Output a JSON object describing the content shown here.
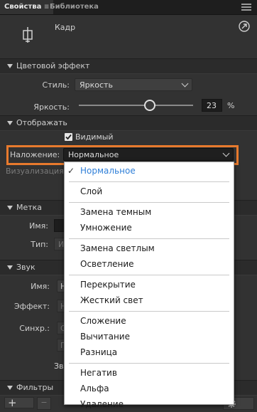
{
  "tabs": [
    {
      "label": "Свойства",
      "close": "≡"
    },
    {
      "label": "Библиотека",
      "close": ""
    }
  ],
  "header": {
    "object_type": "Кадр"
  },
  "color_effect": {
    "title": "Цветовой эффект",
    "style_label": "Стиль:",
    "style_value": "Яркость",
    "brightness_label": "Яркость:",
    "brightness_value": "23",
    "brightness_unit": "%",
    "brightness_slider_fraction": 0.62
  },
  "display": {
    "title": "Отображать",
    "visible_label": "Видимый",
    "visible_checked": true,
    "blend_label": "Наложение:",
    "blend_value": "Нормальное",
    "render_label": "Визуализация:"
  },
  "label_section": {
    "title": "Метка",
    "name_label": "Имя:",
    "type_label": "Тип:",
    "type_value": "И"
  },
  "sound": {
    "title": "Звук",
    "name_label": "Имя:",
    "name_value": "Н",
    "effect_label": "Эффект:",
    "effect_value": "Н",
    "sync_label": "Синхр.:",
    "sync_value": "С",
    "sync_value2": "П",
    "sound_label2": "Зв"
  },
  "filters": {
    "title": "Фильтры",
    "add": "+",
    "remove": "−"
  },
  "blend_menu": {
    "groups": [
      [
        {
          "label": "Нормальное",
          "selected": true
        }
      ],
      [
        {
          "label": "Слой"
        }
      ],
      [
        {
          "label": "Замена темным"
        },
        {
          "label": "Умножение"
        }
      ],
      [
        {
          "label": "Замена светлым"
        },
        {
          "label": "Осветление"
        }
      ],
      [
        {
          "label": "Перекрытие"
        },
        {
          "label": "Жесткий свет"
        }
      ],
      [
        {
          "label": "Сложение"
        },
        {
          "label": "Вычитание"
        },
        {
          "label": "Разница"
        }
      ],
      [
        {
          "label": "Негатив"
        },
        {
          "label": "Альфа"
        },
        {
          "label": "Удаление"
        }
      ]
    ],
    "checkmark": "✓"
  },
  "colors": {
    "accent": "#e87a2d",
    "selected_text": "#2f7fd8"
  }
}
